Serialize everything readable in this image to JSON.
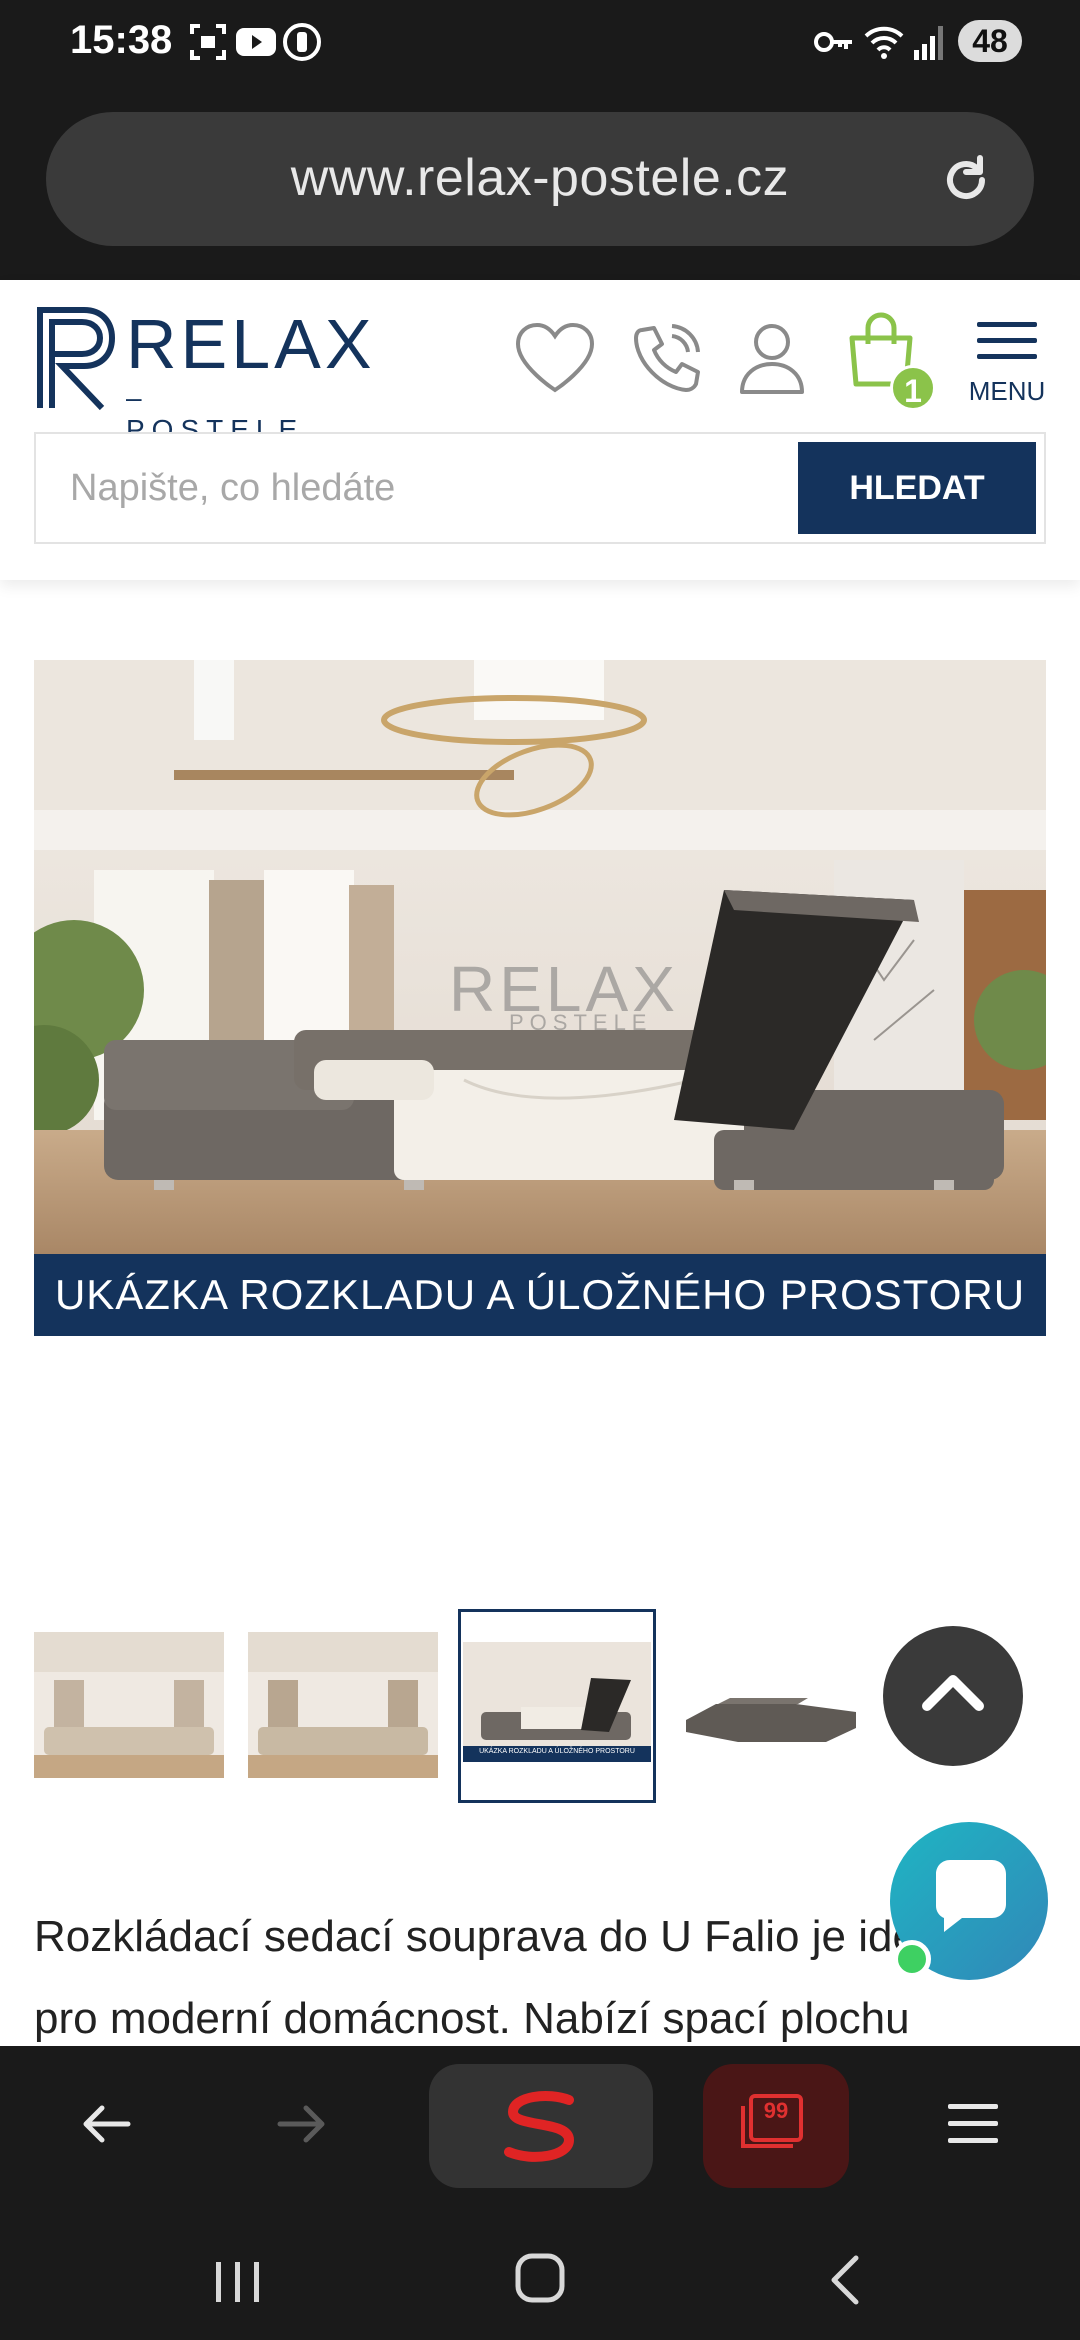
{
  "status_bar": {
    "time": "15:38",
    "battery": "48",
    "icons": [
      "screenshot-icon",
      "youtube-icon",
      "watch-icon",
      "key-icon",
      "wifi-icon",
      "signal-icon"
    ]
  },
  "browser": {
    "url": "www.relax-postele.cz",
    "reload_icon": "reload-icon"
  },
  "site_header": {
    "logo_relax": "RELAX",
    "logo_postele": "– POSTELE –",
    "cart_count": "1",
    "menu_label": "MENU",
    "icons": [
      "heart-icon",
      "phone-icon",
      "user-icon",
      "cart-icon",
      "menu-icon"
    ]
  },
  "search": {
    "placeholder": "Napište, co hledáte",
    "button_label": "HLEDAT"
  },
  "main_image": {
    "banner_text": "UKÁZKA ROZKLADU A ÚLOŽNÉHO PROSTORU",
    "watermark_relax": "RELAX",
    "watermark_postele": "POSTELE"
  },
  "thumbnails": {
    "thumb3_caption": "UKÁZKA ROZKLADU A ÚLOŽNÉHO PROSTORU"
  },
  "description": {
    "line1": "Rozkládací sedací souprava do U Falio je ide",
    "line2": "pro moderní domácnost. Nabízí spací plochu"
  },
  "bottom_bar": {
    "tabs_count": "99"
  },
  "colors": {
    "brand_navy": "#14335c",
    "cart_green": "#8bc34a",
    "chat_teal": "#1fb5c3"
  }
}
